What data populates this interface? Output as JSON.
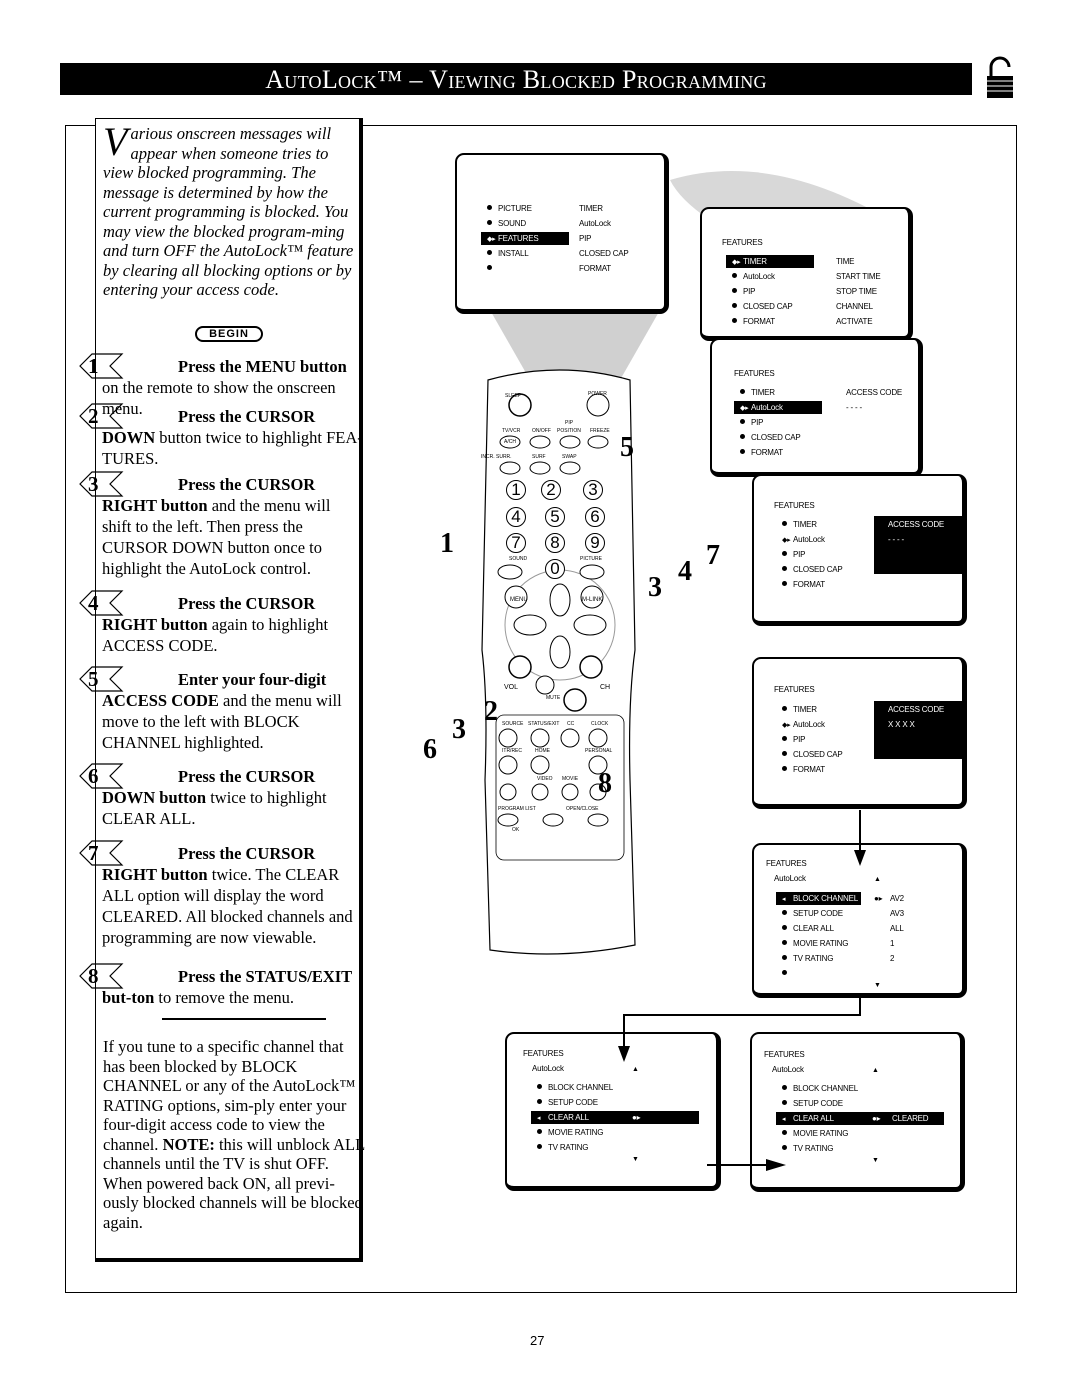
{
  "title": "AutoLock™ – Viewing Blocked Programming",
  "intro": {
    "drop_cap": "V",
    "text": "arious onscreen messages will appear when someone tries to view blocked programming. The message is determined by how the current programming is blocked. You may view the blocked program-ming and turn OFF the AutoLock™ feature by clearing all blocking options or by entering your access code."
  },
  "begin_label": "BEGIN",
  "steps": [
    {
      "num": "1",
      "bold": "Press the MENU button",
      "rest": " on the remote to show the onscreen menu."
    },
    {
      "num": "2",
      "bold": "Press the CURSOR DOWN",
      "rest": " button twice to highlight FEA-TURES."
    },
    {
      "num": "3",
      "bold": "Press the CURSOR RIGHT button",
      "rest": " and the menu will shift to the left. Then press the CURSOR DOWN button once to highlight the AutoLock control."
    },
    {
      "num": "4",
      "bold": "Press the CURSOR RIGHT button",
      "rest": " again to highlight ACCESS CODE."
    },
    {
      "num": "5",
      "bold": "Enter your four-digit ACCESS CODE",
      "rest": " and the menu will move to the left with BLOCK CHANNEL highlighted."
    },
    {
      "num": "6",
      "bold": "Press the CURSOR DOWN button",
      "rest": " twice to highlight CLEAR ALL."
    },
    {
      "num": "7",
      "bold": "Press the CURSOR RIGHT button",
      "rest": " twice. The CLEAR ALL option will display the word CLEARED. All blocked channels and programming are now viewable."
    },
    {
      "num": "8",
      "bold": "Press the STATUS/EXIT but-ton",
      "rest": " to remove the menu."
    }
  ],
  "note": {
    "text": "If you tune to a specific channel that has been blocked by BLOCK CHANNEL or any of the AutoLock™ RATING options, sim-ply enter your four-digit access code to view the channel.",
    "note_label": "NOTE:",
    "note_text": " this will unblock ALL channels until the TV is shut OFF. When powered back ON, all previ-ously blocked channels will be blocked again."
  },
  "screens": [
    {
      "rows": [
        {
          "l": "PICTURE",
          "r": "TIMER"
        },
        {
          "l": "SOUND",
          "r": "AutoLock"
        },
        {
          "l": "FEATURES",
          "r": "PIP",
          "hl": true
        },
        {
          "l": "INSTALL",
          "r": "CLOSED CAP"
        },
        {
          "l": "",
          "r": "FORMAT"
        }
      ]
    },
    {
      "heading": "FEATURES",
      "rows": [
        {
          "l": "TIMER",
          "r": "TIME",
          "hl": true
        },
        {
          "l": "AutoLock",
          "r": "START TIME"
        },
        {
          "l": "PIP",
          "r": "STOP TIME"
        },
        {
          "l": "CLOSED CAP",
          "r": "CHANNEL"
        },
        {
          "l": "FORMAT",
          "r": "ACTIVATE"
        }
      ]
    },
    {
      "heading": "FEATURES",
      "rows": [
        {
          "l": "TIMER",
          "r": "ACCESS CODE"
        },
        {
          "l": "AutoLock",
          "r": "- - - -",
          "hl": true
        },
        {
          "l": "PIP",
          "r": ""
        },
        {
          "l": "CLOSED CAP",
          "r": ""
        },
        {
          "l": "FORMAT",
          "r": ""
        }
      ]
    },
    {
      "heading": "FEATURES",
      "box": [
        "ACCESS CODE",
        "- - - -"
      ],
      "rows": [
        {
          "l": "TIMER"
        },
        {
          "l": "AutoLock",
          "sel": true
        },
        {
          "l": "PIP"
        },
        {
          "l": "CLOSED CAP"
        },
        {
          "l": "FORMAT"
        }
      ]
    },
    {
      "heading": "FEATURES",
      "box": [
        "ACCESS CODE",
        "X X X X"
      ],
      "rows": [
        {
          "l": "TIMER"
        },
        {
          "l": "AutoLock",
          "sel": true
        },
        {
          "l": "PIP"
        },
        {
          "l": "CLOSED CAP"
        },
        {
          "l": "FORMAT"
        }
      ]
    },
    {
      "heading": "FEATURES",
      "sub": "AutoLock",
      "rows": [
        {
          "l": "BLOCK CHANNEL",
          "r": "AV2",
          "hl": true
        },
        {
          "l": "SETUP CODE",
          "r": "AV3"
        },
        {
          "l": "CLEAR ALL",
          "r": "ALL"
        },
        {
          "l": "MOVIE RATING",
          "r": "1"
        },
        {
          "l": "TV RATING",
          "r": "2"
        },
        {
          "l": "",
          "r": ""
        }
      ]
    },
    {
      "heading": "FEATURES",
      "sub": "AutoLock",
      "rows": [
        {
          "l": "BLOCK CHANNEL"
        },
        {
          "l": "SETUP CODE"
        },
        {
          "l": "CLEAR ALL",
          "hl": true,
          "r": ""
        },
        {
          "l": "MOVIE RATING"
        },
        {
          "l": "TV RATING"
        }
      ]
    },
    {
      "heading": "FEATURES",
      "sub": "AutoLock",
      "rows": [
        {
          "l": "BLOCK CHANNEL"
        },
        {
          "l": "SETUP CODE"
        },
        {
          "l": "CLEAR ALL",
          "hl": true,
          "r": "CLEARED"
        },
        {
          "l": "MOVIE RATING"
        },
        {
          "l": "TV RATING"
        }
      ]
    }
  ],
  "remote": {
    "labels": [
      "SLEEP",
      "POWER",
      "PIP",
      "TV/VCR",
      "ON/OFF",
      "POSITION",
      "FREEZE",
      "A/CH",
      "INCR. SURR.",
      "SURF",
      "SWAP",
      "SOUND",
      "PICTURE",
      "MENU",
      "M-LINK",
      "VOL",
      "CH",
      "MUTE",
      "SOURCE",
      "STATUS/EXIT",
      "CC",
      "CLOCK",
      "ITR/REC",
      "HOME",
      "PERSONAL",
      "VIDEO",
      "MOVIE",
      "PROGRAM LIST",
      "OPEN/CLOSE",
      "OK"
    ],
    "digits": [
      "1",
      "2",
      "3",
      "4",
      "5",
      "6",
      "7",
      "8",
      "9",
      "0"
    ]
  },
  "callouts": [
    "1",
    "2",
    "3",
    "4",
    "5",
    "6",
    "7",
    "3",
    "2",
    "8"
  ],
  "page_number": "27"
}
